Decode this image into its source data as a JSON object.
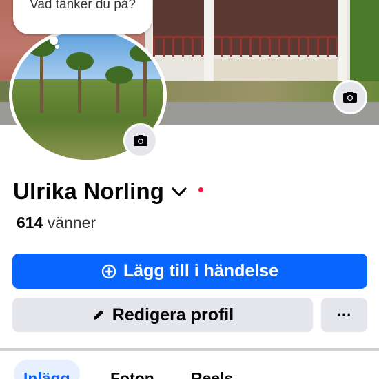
{
  "cover": {
    "camera_icon": "camera-icon"
  },
  "bubble": {
    "text": "Vad tänker du på?"
  },
  "avatar": {
    "camera_icon": "camera-icon"
  },
  "profile": {
    "name": "Ulrika Norling",
    "friends_count": "614",
    "friends_label": "vänner"
  },
  "actions": {
    "primary_label": "Lägg till i händelse",
    "primary_icon": "plus-circle-icon",
    "secondary_label": "Redigera profil",
    "secondary_icon": "pencil-icon",
    "more_label": "···"
  },
  "tabs": [
    {
      "label": "Inlägg",
      "active": true
    },
    {
      "label": "Foton",
      "active": false
    },
    {
      "label": "Reels",
      "active": false
    }
  ],
  "colors": {
    "primary": "#0866ff",
    "secondary_bg": "#e4e6eb",
    "active_tab_bg": "#e7f0fd",
    "notification_dot": "#e41e3f"
  }
}
